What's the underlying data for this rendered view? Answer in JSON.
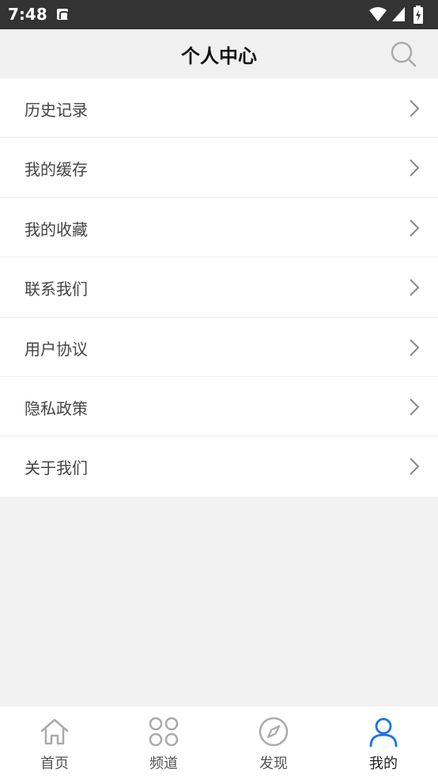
{
  "status_bar": {
    "time": "7:48"
  },
  "header": {
    "title": "个人中心"
  },
  "menu": {
    "items": [
      {
        "label": "历史记录"
      },
      {
        "label": "我的缓存"
      },
      {
        "label": "我的收藏"
      },
      {
        "label": "联系我们"
      },
      {
        "label": "用户协议"
      },
      {
        "label": "隐私政策"
      },
      {
        "label": "关于我们"
      }
    ]
  },
  "tabbar": {
    "items": [
      {
        "label": "首页",
        "icon": "home-icon"
      },
      {
        "label": "频道",
        "icon": "channels-icon"
      },
      {
        "label": "发现",
        "icon": "compass-icon"
      },
      {
        "label": "我的",
        "icon": "user-icon"
      }
    ],
    "active_index": 3
  },
  "colors": {
    "active": "#1a73e8",
    "inactive": "#aaaaaa",
    "background": "#f2f2f2"
  }
}
